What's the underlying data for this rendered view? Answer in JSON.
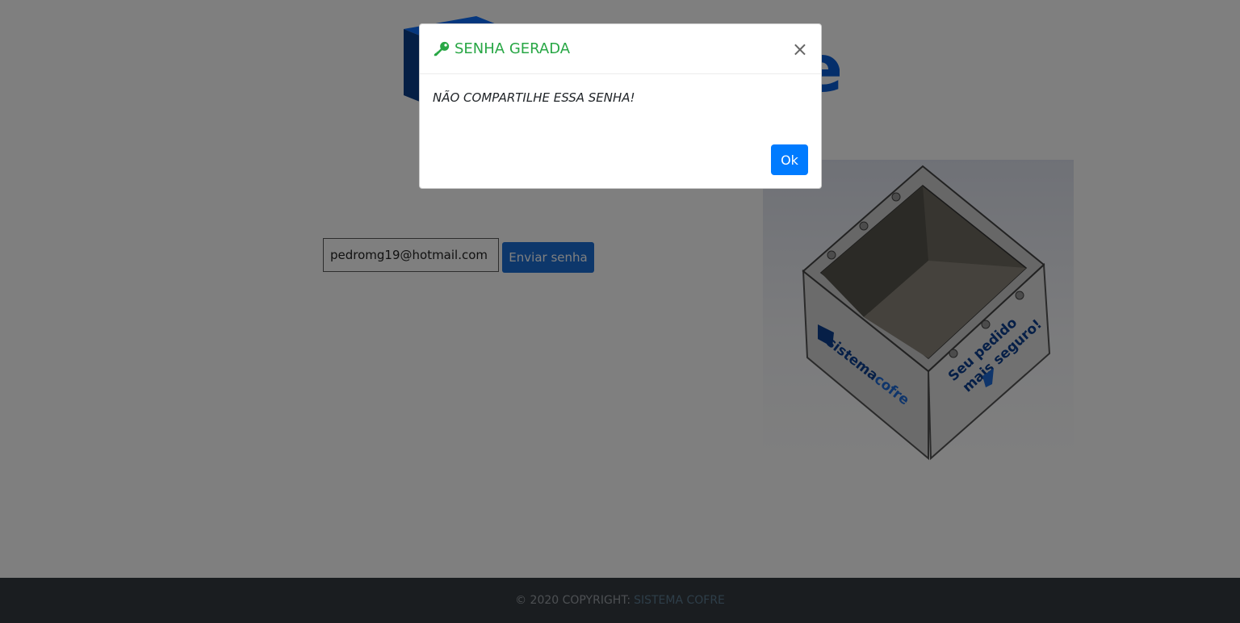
{
  "form": {
    "email_value": "pedromg19@hotmail.com",
    "send_label": "Enviar senha"
  },
  "product_image": {
    "brand_text_prefix": "sistema",
    "brand_text_suffix": "cofre",
    "slogan_line1": "Seu pedido",
    "slogan_line2": "mais seguro!"
  },
  "footer": {
    "copyright": "© 2020 COPYRIGHT:",
    "link": "SISTEMA COFRE"
  },
  "modal": {
    "title": "SENHA GERADA",
    "close_glyph": "×",
    "message": "NÃO COMPARTILHE ESSA SENHA!",
    "ok_label": "Ok"
  },
  "colors": {
    "success": "#28a745",
    "primary": "#007bff",
    "footer_bg": "#343a40",
    "brand_blue": "#0a58ca"
  }
}
